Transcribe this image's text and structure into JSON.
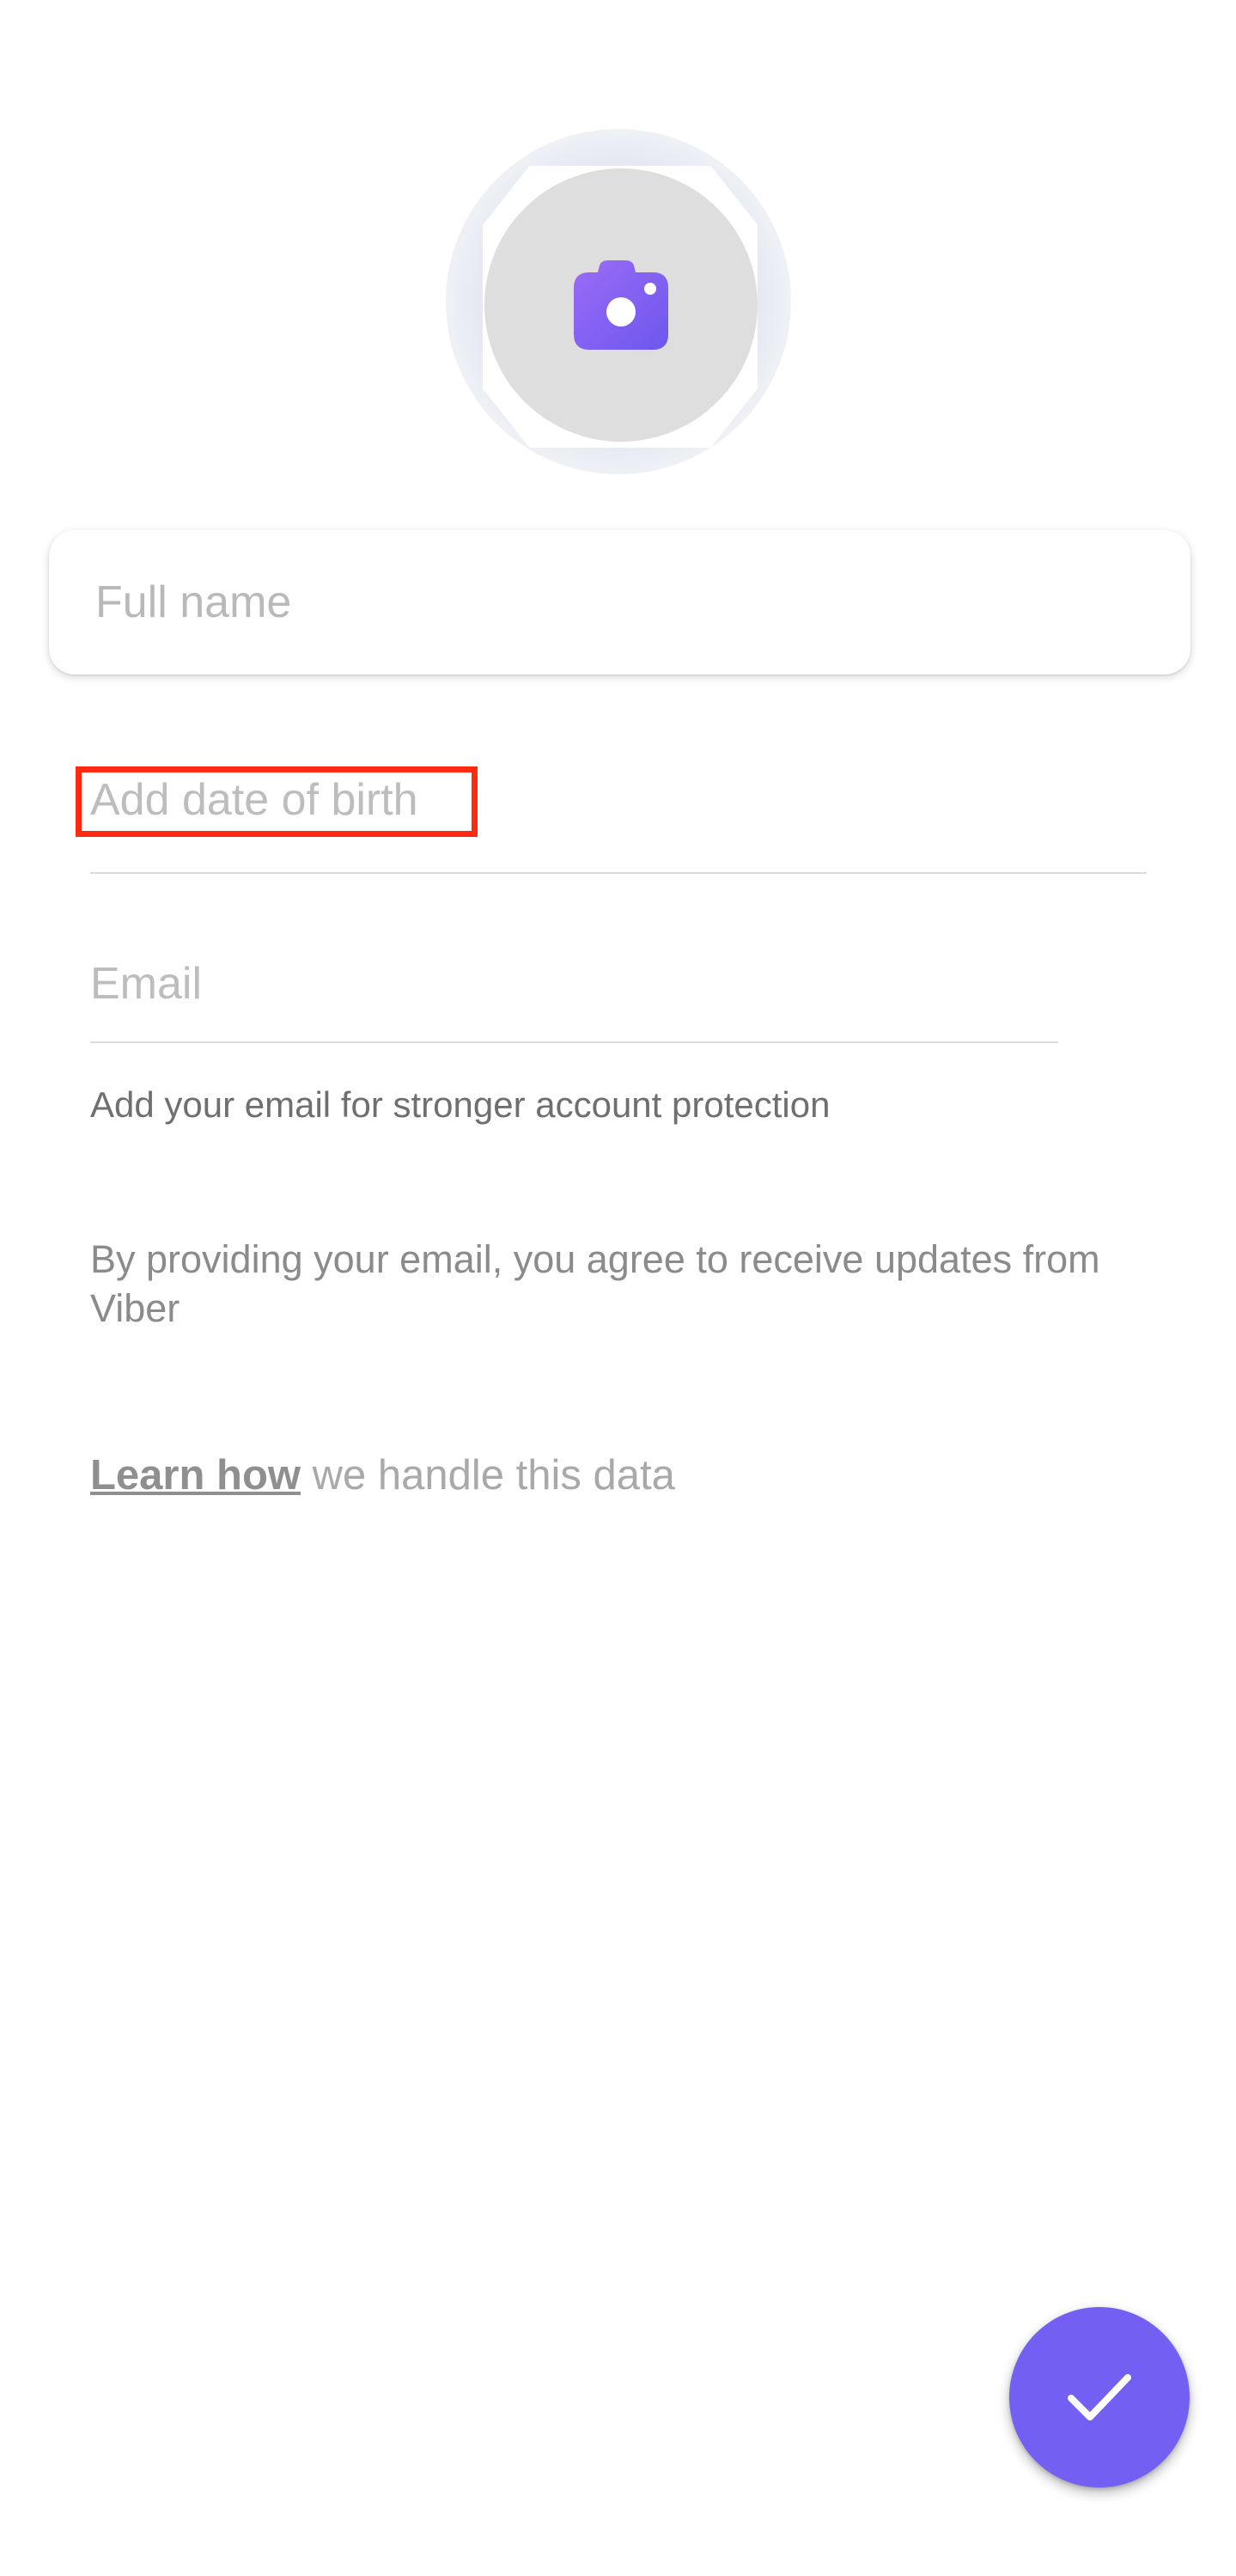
{
  "profile": {
    "photo_icon": "camera-icon",
    "accent_color": "#7360f2",
    "name_placeholder": "Full name",
    "name_value": "",
    "dob_label": "Add date of birth",
    "email_placeholder": "Email",
    "email_value": "",
    "email_hint": "Add your email for stronger account protection",
    "consent_text": "By providing your email, you agree to receive updates from Viber",
    "learn_link": "Learn how",
    "learn_suffix": "we handle this data",
    "confirm_icon": "check-icon"
  }
}
